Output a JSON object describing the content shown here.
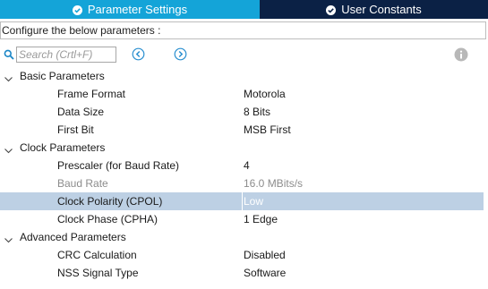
{
  "tabs": [
    {
      "label": "Parameter Settings",
      "icon": "check-circle-icon",
      "active": true
    },
    {
      "label": "User Constants",
      "icon": "check-circle-icon",
      "active": false
    }
  ],
  "configure_text": "Configure the below parameters :",
  "search": {
    "placeholder": "Search (Crtl+F)",
    "value": ""
  },
  "colors": {
    "tab_active": "#14a4d8",
    "tab_inactive": "#0b2145",
    "selection": "#bdd0e4"
  },
  "groups": [
    {
      "label": "Basic Parameters",
      "params": [
        {
          "label": "Frame Format",
          "value": "Motorola"
        },
        {
          "label": "Data Size",
          "value": "8 Bits"
        },
        {
          "label": "First Bit",
          "value": "MSB First"
        }
      ]
    },
    {
      "label": "Clock Parameters",
      "params": [
        {
          "label": "Prescaler (for Baud Rate)",
          "value": "4"
        },
        {
          "label": "Baud Rate",
          "value": "16.0 MBits/s",
          "disabled": true
        },
        {
          "label": "Clock Polarity (CPOL)",
          "value": "Low",
          "selected": true
        },
        {
          "label": "Clock Phase (CPHA)",
          "value": "1 Edge"
        }
      ]
    },
    {
      "label": "Advanced Parameters",
      "params": [
        {
          "label": "CRC Calculation",
          "value": "Disabled"
        },
        {
          "label": "NSS Signal Type",
          "value": "Software"
        }
      ]
    }
  ]
}
